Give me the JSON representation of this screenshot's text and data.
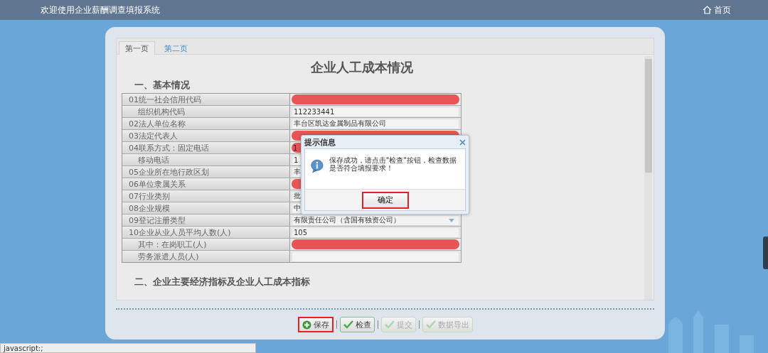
{
  "header": {
    "title": "欢迎使用企业薪酬调查填报系统",
    "home_link": "首页"
  },
  "tabs": [
    {
      "label": "第一页",
      "selected": true
    },
    {
      "label": "第二页",
      "selected": false
    }
  ],
  "form": {
    "title": "企业人工成本情况",
    "section_1": "一、基本情况",
    "rows": [
      {
        "label": "01统一社会信用代码",
        "indent": false,
        "redacted": true
      },
      {
        "label": "组织机构代码",
        "indent": true,
        "value": "112233441",
        "redacted": false
      },
      {
        "label": "02法人单位名称",
        "indent": false,
        "value": "丰台区凯达金属制品有限公司",
        "redacted": false
      },
      {
        "label": "03法定代表人",
        "indent": false,
        "redacted": true
      },
      {
        "label": "04联系方式：固定电话",
        "indent": false,
        "value": "1",
        "redacted": true
      },
      {
        "label": "移动电话",
        "indent": true,
        "value": "1",
        "redacted": false
      },
      {
        "label": "05企业所在地行政区划",
        "indent": false,
        "value": "丰",
        "redacted": false
      },
      {
        "label": "06单位隶属关系",
        "indent": false,
        "redacted": true
      },
      {
        "label": "07行业类别",
        "indent": false,
        "value": "批",
        "redacted": false
      },
      {
        "label": "08企业规模",
        "indent": false,
        "value": "中",
        "redacted": false
      },
      {
        "label": "09登记注册类型",
        "indent": false,
        "value": "有限责任公司（含国有独资公司）",
        "redacted": false,
        "dropdown": true
      },
      {
        "label": "10企业从业人员平均人数(人)",
        "indent": false,
        "value": "105",
        "redacted": false
      },
      {
        "label": "其中：在岗职工(人)",
        "indent": true,
        "redacted": true
      },
      {
        "label": "劳务派遣人员(人)",
        "indent": true,
        "redacted": false
      }
    ],
    "section_2": "二、企业主要经济指标及企业人工成本指标"
  },
  "toolbar": [
    {
      "label": "保存",
      "kind": "add",
      "disabled": false,
      "highlighted": true
    },
    {
      "label": "检查",
      "kind": "check",
      "disabled": false,
      "highlighted": false
    },
    {
      "label": "提交",
      "kind": "check",
      "disabled": true,
      "highlighted": false
    },
    {
      "label": "数据导出",
      "kind": "check",
      "disabled": true,
      "highlighted": false
    }
  ],
  "dialog": {
    "title": "提示信息",
    "message": "保存成功，请点击\"检查\"按钮，检查数据是否符合填报要求！",
    "button": {
      "label": "确定",
      "highlighted": true
    }
  },
  "status_bar": "javascript:;"
}
